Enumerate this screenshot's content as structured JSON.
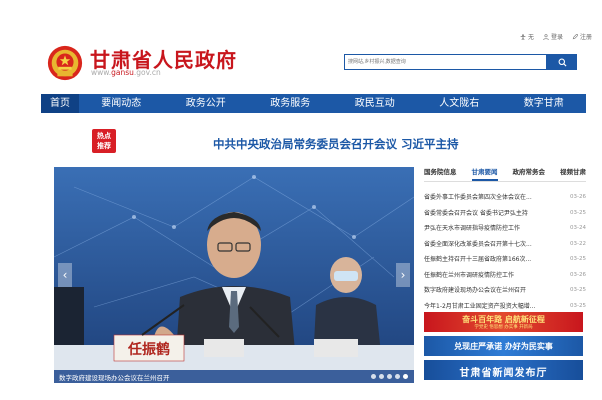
{
  "topbar": {
    "accessibility": "无",
    "login": "登录",
    "register": "注册"
  },
  "site": {
    "title": "甘肃省人民政府",
    "url_prefix": "www.",
    "url_domain": "gansu",
    "url_suffix": ".gov.cn",
    "brand_color": "#c8161d"
  },
  "search": {
    "placeholder": "搜网站,乡村振兴,数据查询"
  },
  "nav": {
    "items": [
      "首页",
      "要闻动态",
      "政务公开",
      "政务服务",
      "政民互动",
      "人文陇右",
      "数字甘肃"
    ],
    "color": "#1c58a6"
  },
  "hot": {
    "badge_line1": "热点",
    "badge_line2": "推荐",
    "headline": "中共中央政治局常务委员会召开会议 习近平主持"
  },
  "carousel": {
    "caption": "数字政府建设现场办公会议在兰州召开",
    "nameplate": "任振鹤",
    "slide_count": 5,
    "active_slide": 5
  },
  "news": {
    "tabs": [
      "国务院信息",
      "甘肃要闻",
      "政府常务会",
      "视频甘肃"
    ],
    "active_tab": 1,
    "items": [
      {
        "title": "省委外事工作委员会第四次全体会议在...",
        "date": "03-26"
      },
      {
        "title": "省委常委会召开会议 省委书记尹弘主持",
        "date": "03-25"
      },
      {
        "title": "尹弘在天水市调研指导疫情防控工作",
        "date": "03-24"
      },
      {
        "title": "省委全面深化改革委员会召开第十七次...",
        "date": "03-22"
      },
      {
        "title": "任振鹤主持召开十三届省政府第166次...",
        "date": "03-25"
      },
      {
        "title": "任振鹤在兰州市调研疫情防控工作",
        "date": "03-26"
      },
      {
        "title": "数字政府建设现场办公会议在兰州召开",
        "date": "03-25"
      },
      {
        "title": "今年1-2月甘肃工业固定资产投资大幅增...",
        "date": "03-25"
      }
    ]
  },
  "banners": {
    "b1": "奋斗百年路 启航新征程",
    "b1_sub": "学党史 悟思想 办实事 开新局",
    "b2": "兑现庄严承诺 办好为民实事",
    "b3": "甘肃省新闻发布厅"
  }
}
